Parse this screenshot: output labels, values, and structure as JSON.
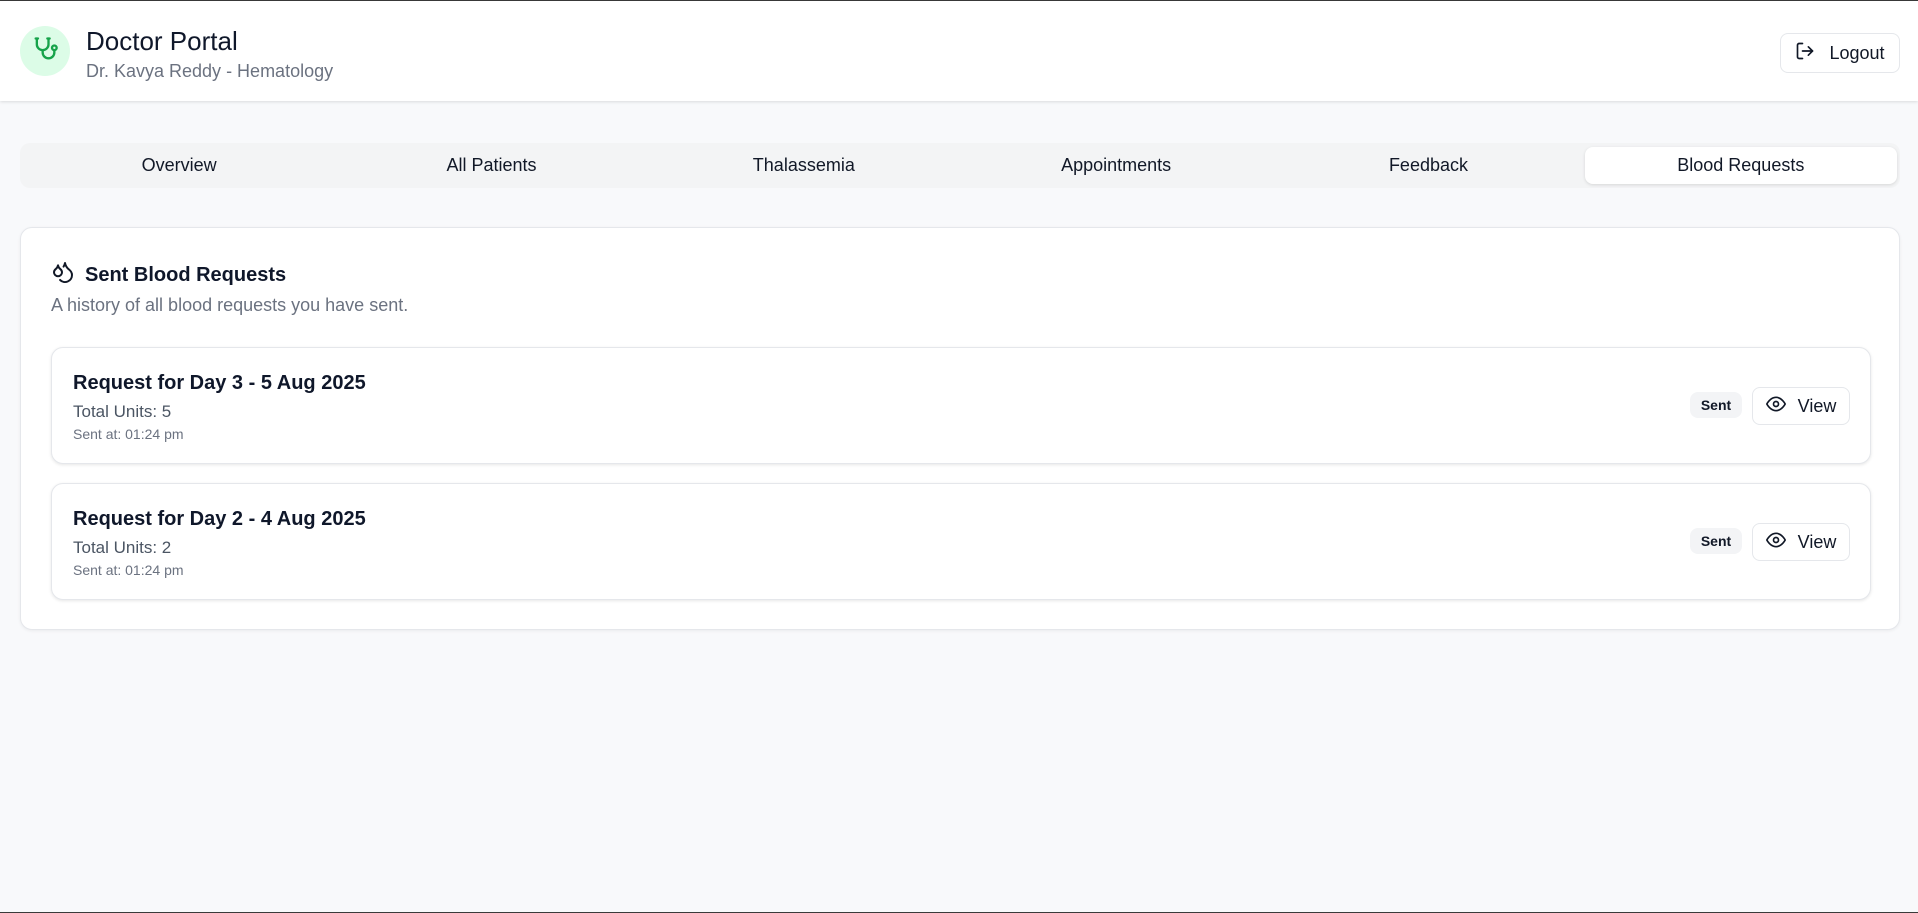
{
  "header": {
    "title": "Doctor Portal",
    "subtitle": "Dr. Kavya Reddy - Hematology",
    "logout_label": "Logout",
    "logo_icon": "stethoscope-icon",
    "accent_color": "#16a34a"
  },
  "tabs": [
    {
      "label": "Overview",
      "active": false
    },
    {
      "label": "All Patients",
      "active": false
    },
    {
      "label": "Thalassemia",
      "active": false
    },
    {
      "label": "Appointments",
      "active": false
    },
    {
      "label": "Feedback",
      "active": false
    },
    {
      "label": "Blood Requests",
      "active": true
    }
  ],
  "panel": {
    "title": "Sent Blood Requests",
    "description": "A history of all blood requests you have sent.",
    "icon": "blood-drops-icon"
  },
  "requests": [
    {
      "title": "Request for Day 3 - 5 Aug 2025",
      "units": "Total Units: 5",
      "sent_at": "Sent at: 01:24 pm",
      "status": "Sent",
      "view_label": "View"
    },
    {
      "title": "Request for Day 2 - 4 Aug 2025",
      "units": "Total Units: 2",
      "sent_at": "Sent at: 01:24 pm",
      "status": "Sent",
      "view_label": "View"
    }
  ]
}
